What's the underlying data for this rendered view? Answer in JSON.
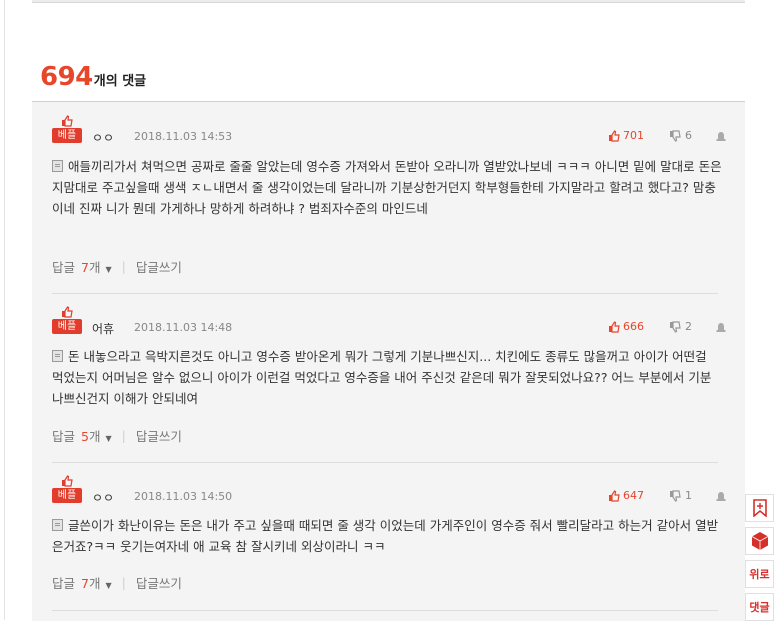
{
  "header": {
    "count": "694",
    "count_label": "개의 댓글"
  },
  "best_badge": "베플",
  "reply_label": "답글",
  "reply_unit": "개",
  "write_reply_label": "답글쓰기",
  "comments": [
    {
      "author": "ㅇㅇ",
      "date": "2018.11.03 14:53",
      "likes": "701",
      "dislikes": "6",
      "text": "애들끼리가서 쳐먹으면 공짜로 줄줄 알았는데 영수증 가져와서 돈받아 오라니까 열받았나보네 ㅋㅋㅋ 아니면 밑에 말대로 돈은 지맘대로 주고싶을때 생색 ㅈㄴ내면서 줄 생각이었는데 달라니까 기분상한거던지 학부형들한테 가지말라고 할려고 했다고? 맘충이네 진짜 니가 뭔데 가게하나 망하게 하려하냐 ? 범죄자수준의 마인드네",
      "reply_count": "7"
    },
    {
      "author": "어휴",
      "date": "2018.11.03 14:48",
      "likes": "666",
      "dislikes": "2",
      "text": "돈 내놓으라고 윽박지른것도 아니고 영수증 받아온게 뭐가 그렇게 기분나쁘신지... 치킨에도 종류도 많을꺼고 아이가 어떤걸 먹었는지 어머님은 알수 없으니 아이가 이런걸 먹었다고 영수증을 내어 주신것 같은데 뭐가 잘못되었나요?? 어느 부분에서 기분나쁘신건지 이해가 안되네여",
      "reply_count": "5"
    },
    {
      "author": "ㅇㅇ",
      "date": "2018.11.03 14:50",
      "likes": "647",
      "dislikes": "1",
      "text": "글쓴이가 화난이유는 돈은 내가 주고 싶을때 때되면 줄 생각 이었는데 가게주인이 영수증 줘서 빨리달라고 하는거 같아서 열받은거죠?ㅋㅋ 웃기는여자네 애 교육 참 잘시키네 외상이라니 ㅋㅋ",
      "reply_count": "7"
    }
  ],
  "sidebar": {
    "top_label": "위로",
    "comment_label": "댓글"
  }
}
